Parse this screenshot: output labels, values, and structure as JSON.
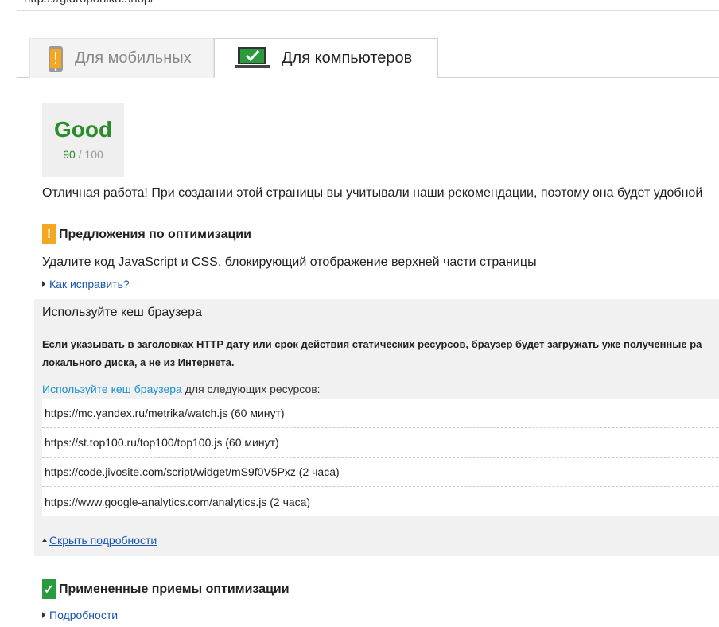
{
  "url": "https://gidroponika.shop/",
  "tabs": [
    {
      "label": "Для мобильных",
      "active": false,
      "icon": "phone-icon"
    },
    {
      "label": "Для компьютеров",
      "active": true,
      "icon": "monitor-icon"
    }
  ],
  "score": {
    "word": "Good",
    "value": "90",
    "max": "/ 100",
    "color": "#2b8c2b"
  },
  "summary": "Отличная работа! При создании этой страницы вы учитывали наши рекомендации, поэтому она будет удобной",
  "suggestions": {
    "heading": "Предложения по оптимизации",
    "badge": "!",
    "rule1": {
      "title": "Удалите код JavaScript и CSS, блокирующий отображение верхней части страницы",
      "link": "Как исправить?"
    },
    "rule2": {
      "title": "Используйте кеш браузера",
      "description": "Если указывать в заголовках HTTP дату или срок действия статических ресурсов, браузер будет загружать уже полученные ра локального диска, а не из Интернета.",
      "intro_link": "Используйте кеш браузера",
      "intro_rest": " для следующих ресурсов:",
      "resources": [
        "https://mc.yandex.ru/metrika/watch.js (60 минут)",
        "https://st.top100.ru/top100/top100.js (60 минут)",
        "https://code.jivosite.com/script/widget/mS9f0V5Pxz (2 часа)",
        "https://www.google-analytics.com/analytics.js (2 часа)"
      ],
      "hide_link": "Скрыть подробности"
    }
  },
  "applied": {
    "heading": "Примененные приемы оптимизации",
    "badge": "✓",
    "link": "Подробности"
  },
  "colors": {
    "warn": "#f5a623",
    "ok": "#2b9a3c",
    "link": "#1a56b0"
  }
}
